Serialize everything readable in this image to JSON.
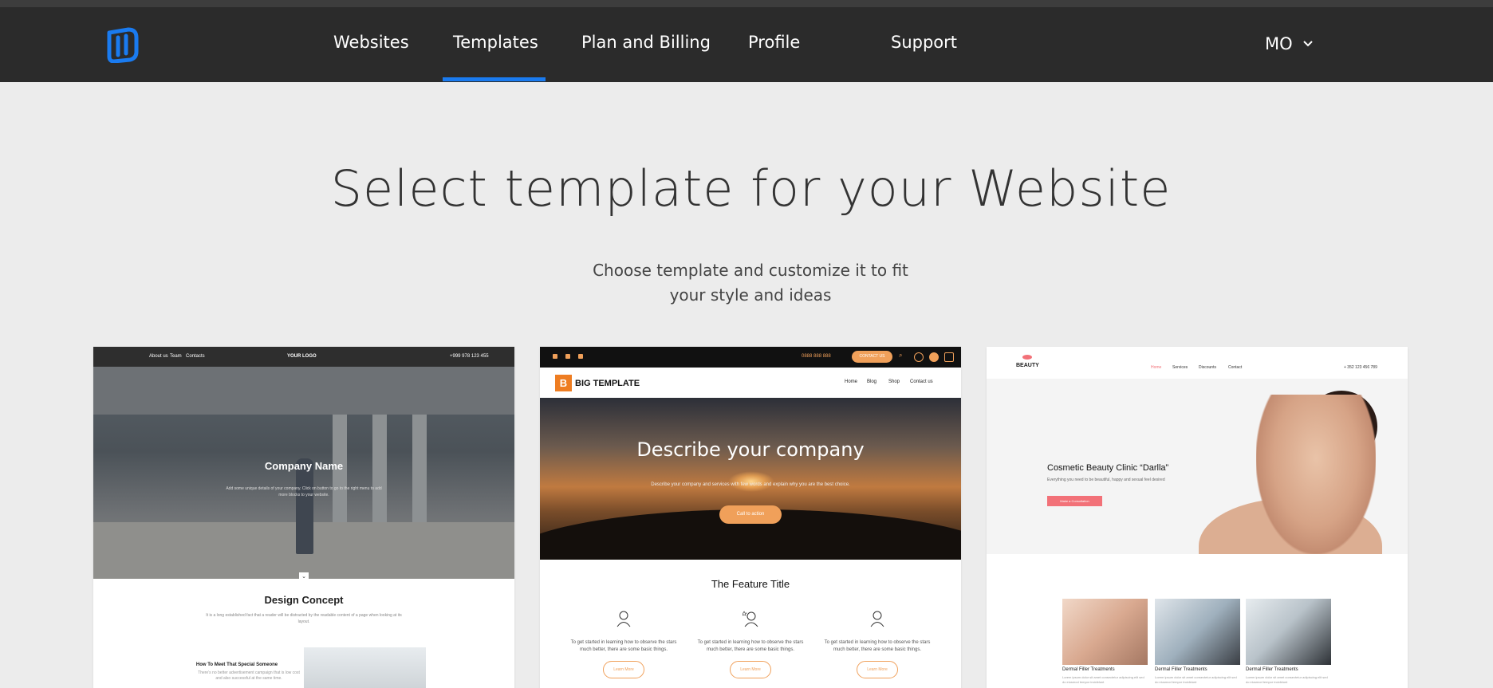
{
  "nav": {
    "links": [
      "Websites",
      "Templates",
      "Plan and Billing",
      "Profile",
      "Support"
    ],
    "active": "Templates",
    "user_initials": "MO",
    "accent": "#1a7bf0"
  },
  "page": {
    "title": "Select template for your Website",
    "subtitle": "Choose template and customize it to fit your style and ideas"
  },
  "templates": [
    {
      "topbar_left": [
        "About us",
        "Team",
        "Contacts"
      ],
      "topbar_logo": "YOUR LOGO",
      "topbar_phone": "+999 978 123 455",
      "hero_title": "Company Name",
      "hero_desc": "Add some unique details of your company. Click on button to go to the right menu to add more blocks to your website.",
      "section_title": "Design Concept",
      "section_text": "It is a long established fact that a reader will be distracted by the readable content of a page when looking at its layout.",
      "sub_title": "How To Meet That Special Someone",
      "sub_text": "There's no better advertisement campaign that is low cost and also successful at the same time."
    },
    {
      "phone": "0888 888 888",
      "contact_btn": "CONTACT US",
      "brand_letter": "B",
      "brand": "BIG TEMPLATE",
      "menu": [
        "Home",
        "Blog",
        "Shop",
        "Contact us"
      ],
      "hero_title": "Describe your company",
      "hero_desc": "Describe your company and services with few words and explain why you are the best choice.",
      "cta": "Call to action",
      "feature_title": "The Feature Title",
      "feature_text": "To get started in learning how to observe the stars much better, there are some basic things.",
      "feature_btn": "Learn More",
      "brand_color": "#ee7d22"
    },
    {
      "brand": "BEAUTY",
      "menu": [
        "Home",
        "Services",
        "Discounts",
        "Contact"
      ],
      "phone": "+ 352 123 456 789",
      "hero_title": "Cosmetic Beauty Clinic “Darlla”",
      "hero_sub": "Everything you need to be beautiful, happy and sexual feel desired",
      "hero_btn": "Make a Consultation",
      "service_title": "Dermal Filler Treatments",
      "service_text": "Lorem ipsum dolor sit amet consectetur adipiscing elit sed do eiusmod tempor incididunt",
      "accent": "#f27178"
    }
  ]
}
